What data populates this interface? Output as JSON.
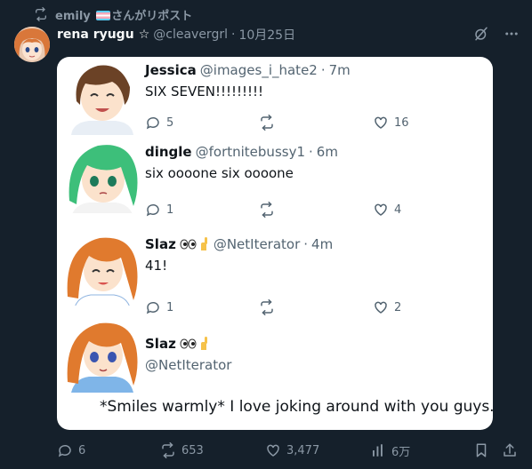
{
  "repost": {
    "user": "emily",
    "suffix": "さんがリポスト"
  },
  "tweet": {
    "name": "rena ryugu",
    "star": "☆",
    "handle": "@cleavergrl",
    "dot": "·",
    "date": "10月25日"
  },
  "replies": [
    {
      "name": "Jessica",
      "handle": "@images_i_hate2",
      "dot": "·",
      "time": "7m",
      "text": "SIX SEVEN!!!!!!!!!",
      "replies": "5",
      "retweets": "",
      "likes": "16"
    },
    {
      "name": "dingle",
      "handle": "@fortnitebussy1",
      "dot": "·",
      "time": "6m",
      "text": "six oooone six oooone",
      "replies": "1",
      "retweets": "",
      "likes": "4"
    },
    {
      "name": "Slaz",
      "handle": "@NetIterator",
      "dot": "·",
      "time": "4m",
      "text": "41!",
      "replies": "1",
      "retweets": "",
      "likes": "2"
    },
    {
      "name": "Slaz",
      "handle": "@NetIterator",
      "text": "*Smiles warmly* I love joking around with you guys..."
    }
  ],
  "footer": {
    "replies": "6",
    "retweets": "653",
    "likes": "3,477",
    "views": "6万"
  },
  "icons": {
    "repost": "repost-icon",
    "grok": "grok-icon",
    "more": "more-icon",
    "reply": "reply-icon",
    "like": "heart-icon",
    "views": "views-icon",
    "bookmark": "bookmark-icon",
    "share": "share-icon"
  },
  "colors": {
    "background": "#15202b",
    "secondary_text": "#8b98a5",
    "card": "#ffffff"
  }
}
